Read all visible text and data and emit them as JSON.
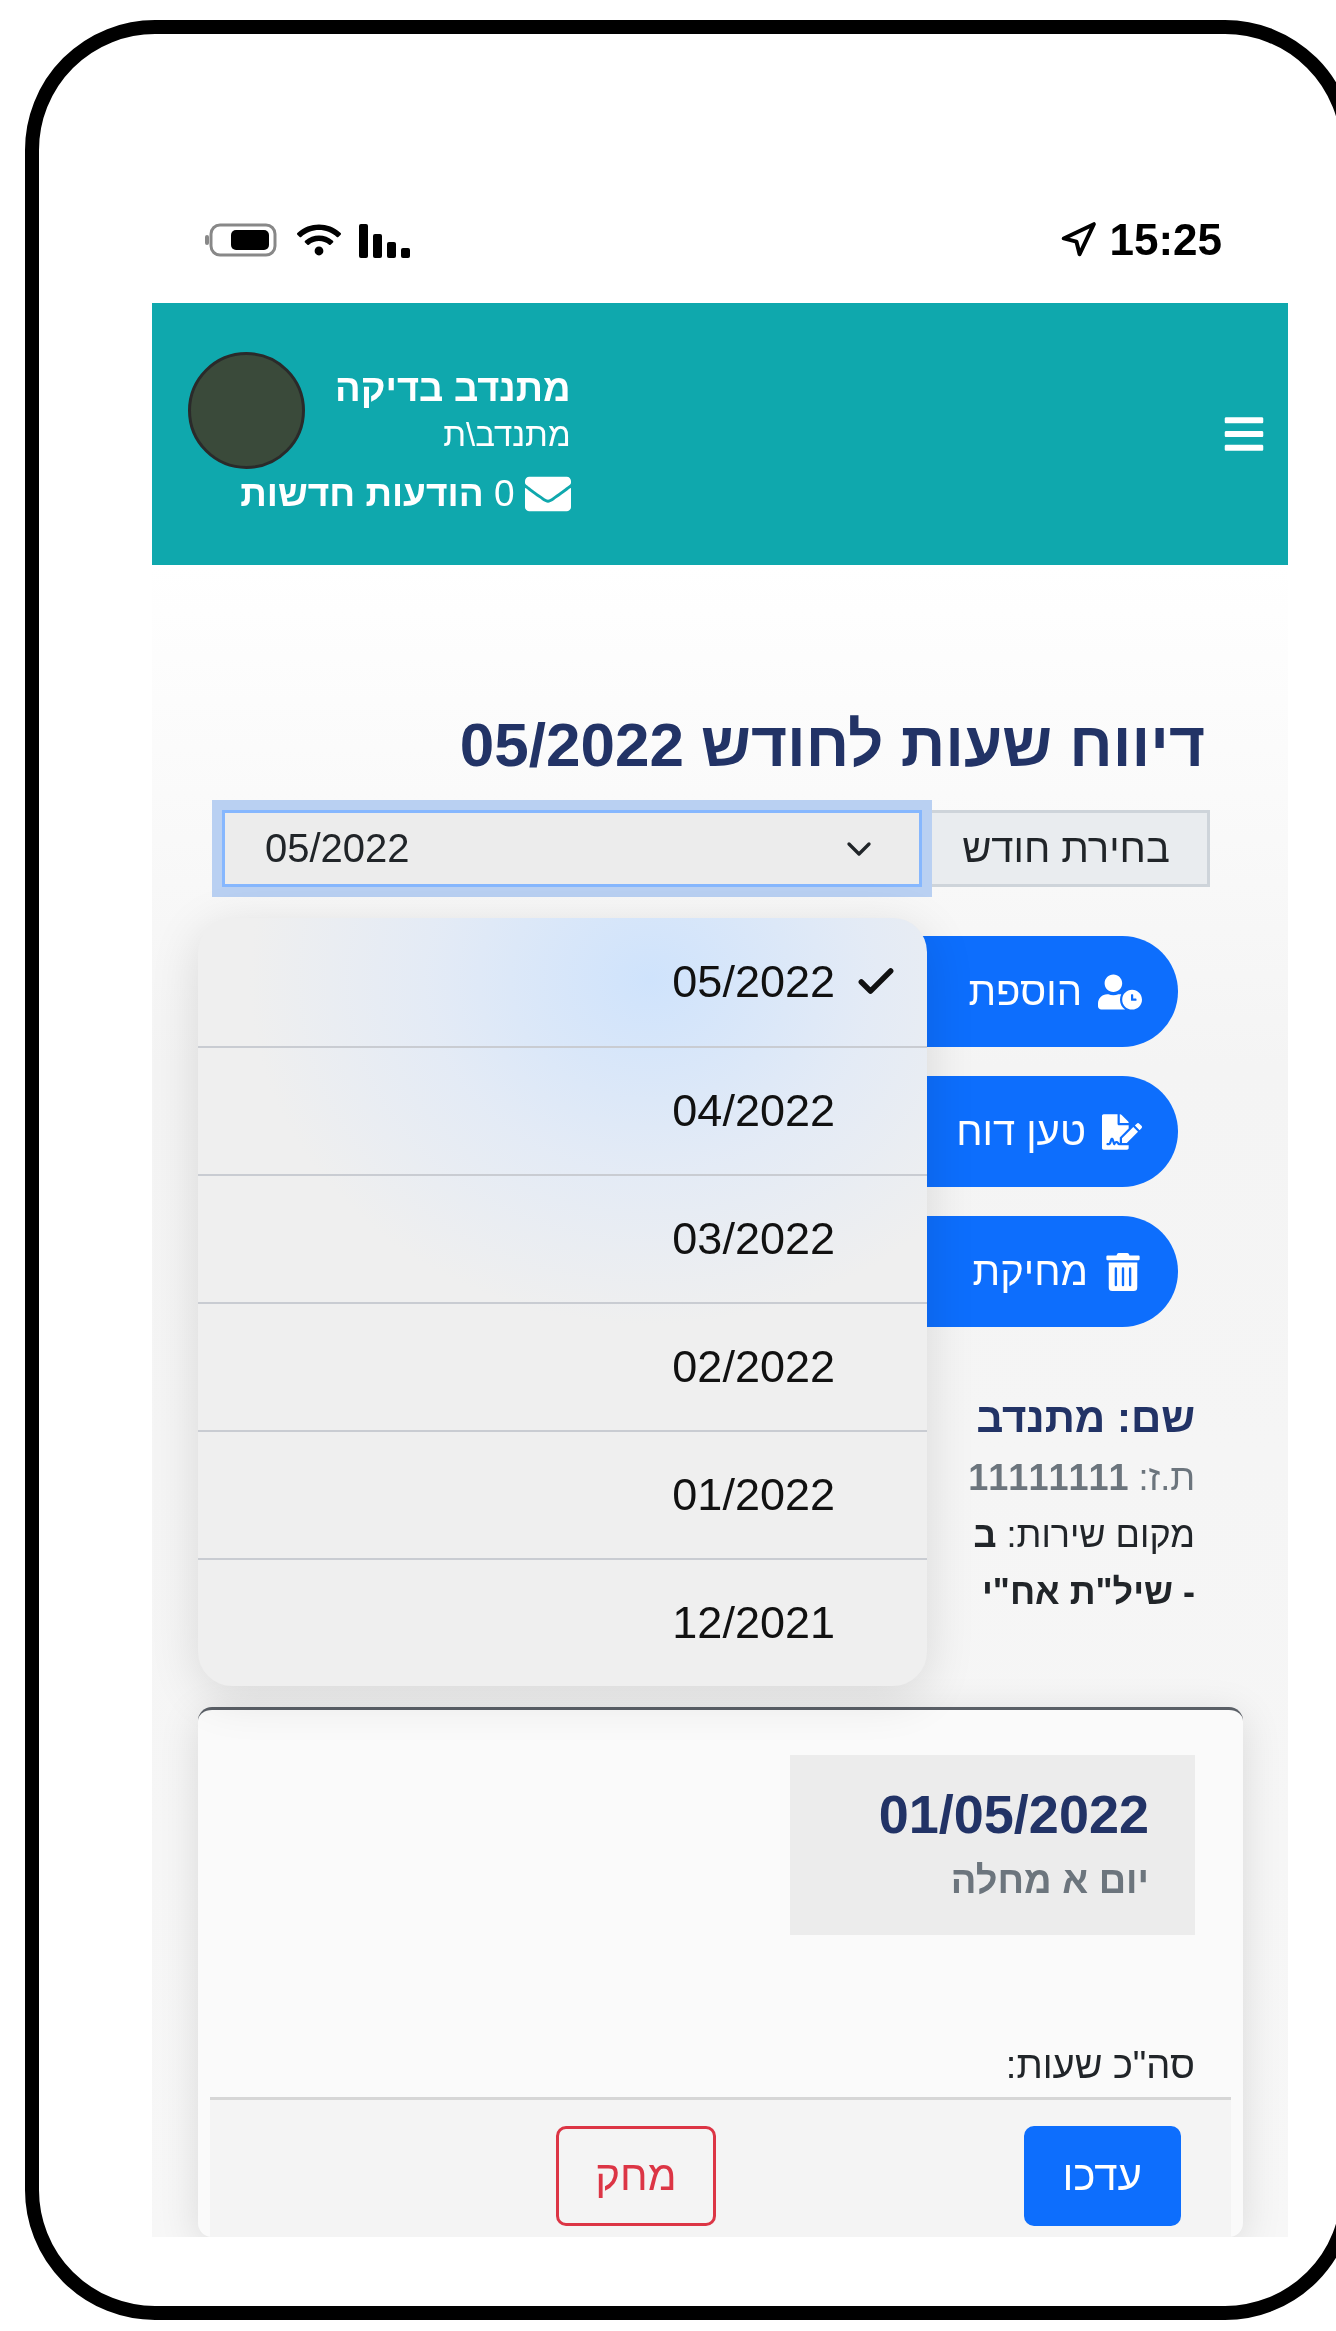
{
  "status_bar": {
    "time": "15:25"
  },
  "header": {
    "user_name": "מתנדב בדיקה",
    "role": "מתנדב\\ת",
    "messages": "0 **הודעות חדשות**"
  },
  "title": "דיווח שעות לחודש 05/2022",
  "month_select": {
    "label": "בחירת חודש",
    "value": "05/2022",
    "options": [
      {
        "label": "05/2022",
        "selected": true
      },
      {
        "label": "04/2022",
        "selected": false
      },
      {
        "label": "03/2022",
        "selected": false
      },
      {
        "label": "02/2022",
        "selected": false
      },
      {
        "label": "01/2022",
        "selected": false
      },
      {
        "label": "12/2021",
        "selected": false
      }
    ]
  },
  "actions": [
    {
      "kind": "add-hours",
      "label": "הוספת"
    },
    {
      "kind": "upload-report",
      "label": "טען דוח"
    },
    {
      "kind": "delete",
      "label": "מחיקת"
    }
  ],
  "volunteer": [
    {
      "kind": "name",
      "text": "שם: מתנדב"
    },
    {
      "kind": "id",
      "text": "ת.ז: **11111111**"
    },
    {
      "kind": "place",
      "text": "מקום שירות: **ב**"
    },
    {
      "kind": "unit",
      "text": "- שיל\"ת אח\"י"
    }
  ],
  "day_card": {
    "date": "01/05/2022",
    "day": "יום א מחלה",
    "total_label": "סה\"כ שעות:",
    "buttons": [
      {
        "kind": "primary",
        "label": "עדכו"
      },
      {
        "kind": "outline-danger",
        "label": "מחק"
      }
    ]
  }
}
